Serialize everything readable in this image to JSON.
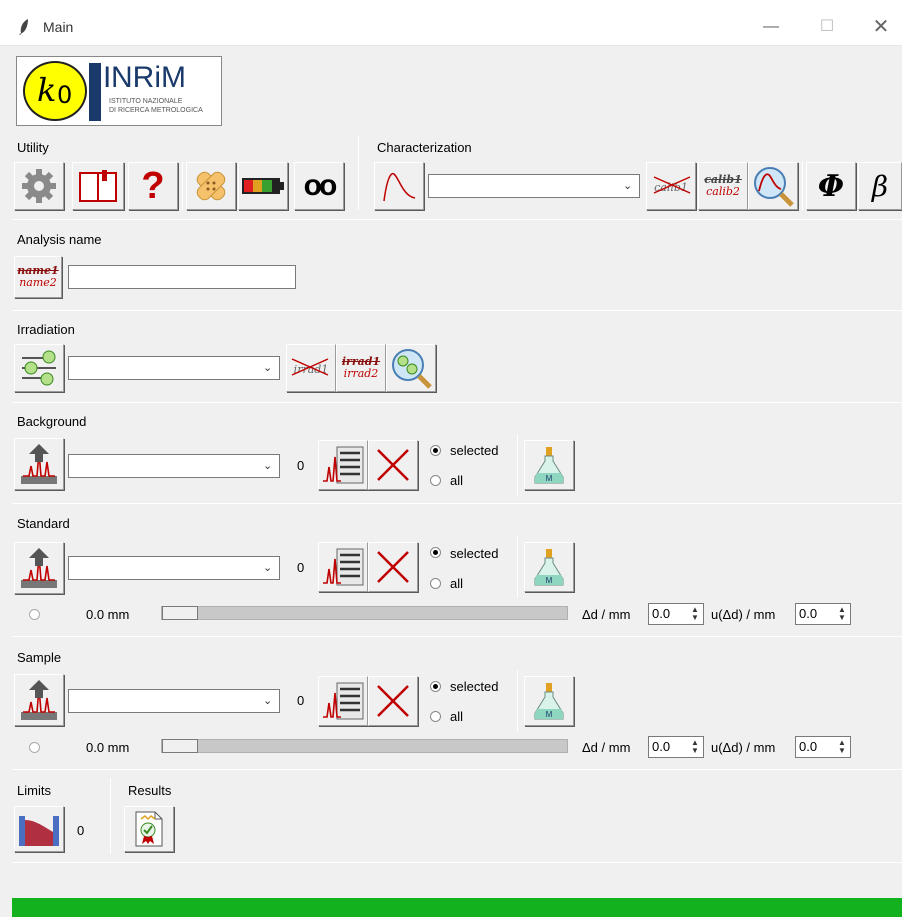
{
  "window": {
    "title": "Main",
    "minimize_glyph": "—",
    "maximize_glyph": "☐",
    "close_glyph": "✕"
  },
  "logo": {
    "ko_text": "k",
    "ko_sub": "0",
    "inrim_text": "NRiM",
    "inrim_prefix": "I",
    "line1": "ISTITUTO NAZIONALE",
    "line2": "DI RICERCA METROLOGICA"
  },
  "utility": {
    "label": "Utility",
    "question": "?",
    "glasses": "oo"
  },
  "characterization": {
    "label": "Characterization",
    "selected": "",
    "calib1": "calib1",
    "calib1b": "calib1",
    "calib2": "calib2",
    "phi": "Φ",
    "beta": "β"
  },
  "analysis": {
    "label": "Analysis name",
    "name1": "name1",
    "name2": "name2",
    "value": ""
  },
  "irradiation": {
    "label": "Irradiation",
    "selected": "",
    "irrad1": "irrad1",
    "irrad1b": "irrad1",
    "irrad2": "irrad2"
  },
  "background": {
    "label": "Background",
    "selected": "",
    "count": "0",
    "radio_selected": "selected",
    "radio_all": "all",
    "m": "M"
  },
  "standard": {
    "label": "Standard",
    "selected": "",
    "count": "0",
    "radio_selected": "selected",
    "radio_all": "all",
    "m": "M",
    "distance": "0.0 mm",
    "dd_label": "Δd / mm",
    "dd_value": "0.0",
    "udd_label": "u(Δd) / mm",
    "udd_value": "0.0",
    "slider_level": 0
  },
  "sample": {
    "label": "Sample",
    "selected": "",
    "count": "0",
    "radio_selected": "selected",
    "radio_all": "all",
    "m": "M",
    "distance": "0.0 mm",
    "dd_label": "Δd / mm",
    "dd_value": "0.0",
    "udd_label": "u(Δd) / mm",
    "udd_value": "0.0",
    "slider_level": 0
  },
  "limits": {
    "label": "Limits",
    "count": "0"
  },
  "results": {
    "label": "Results"
  },
  "colors": {
    "accent_green": "#14b11e",
    "red": "#c00000",
    "logo_yellow": "#ffff00",
    "logo_navy": "#1a3a6b"
  }
}
